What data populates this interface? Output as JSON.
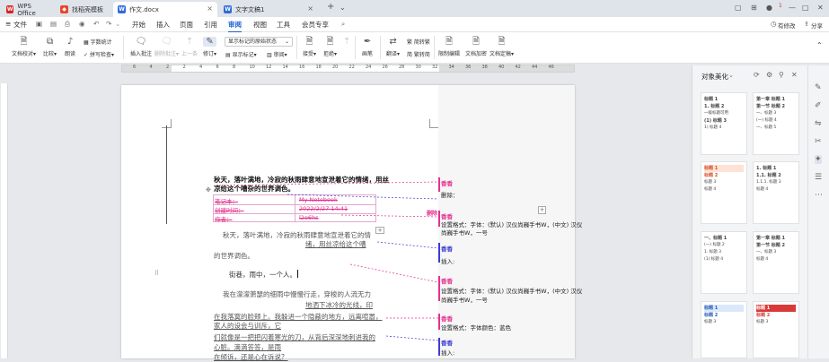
{
  "titlebar": {
    "tabs": [
      {
        "label": "WPS Office",
        "icon": "wps-icon"
      },
      {
        "label": "找稻壳模板",
        "icon": "docer-icon"
      },
      {
        "label": "作文.docx",
        "icon": "word-doc-icon"
      },
      {
        "label": "文字文稿1",
        "icon": "word-doc-icon"
      }
    ],
    "badge": "1"
  },
  "menubar": {
    "file_label": "文件",
    "items": [
      "开始",
      "插入",
      "页面",
      "引用",
      "审阅",
      "视图",
      "工具",
      "会员专享"
    ],
    "active": "审阅",
    "right_label": "有修改",
    "share_label": "分享"
  },
  "ribbon": {
    "buttons": [
      "文档校对",
      "比较",
      "朗读",
      "字数统计",
      "拼写检查",
      "插入批注",
      "删除批注",
      "上一条",
      "下一条",
      "修订",
      "显示标记",
      "审阅",
      "接受",
      "拒绝",
      "画笔",
      "翻译",
      "简转繁",
      "繁转简",
      "限制编辑",
      "文档加密",
      "文档定稿"
    ],
    "markup_combo": "显示标记的原始状态"
  },
  "ruler": {
    "numbers": [
      "6",
      "4",
      "2",
      "2",
      "4",
      "6",
      "8",
      "10",
      "12",
      "14",
      "16",
      "18",
      "20",
      "22",
      "24",
      "26",
      "28",
      "30",
      "32",
      "34",
      "36",
      "38",
      "40",
      "42",
      "44",
      "46"
    ]
  },
  "document": {
    "heading_line1": "秋天，落叶满地，冷寂的秋雨肆意地宣泄着它的情绪，用丝",
    "heading_line2": "凉给这个嘈杂的世界调色。",
    "table": [
      {
        "label": "笔记本：",
        "value": "My Notebook"
      },
      {
        "label": "创建时间：",
        "value": "2022/2/27 14:41"
      },
      {
        "label": "作者：",
        "value": "l2o6hs"
      }
    ],
    "para1_line1": "秋天，落叶满地，冷寂的秋雨肆意地宣泄着它的情",
    "para1_line2": "绪，用丝凉给这个嘈",
    "para1_line3": "的世界调色。",
    "para2": "街巷，雨中，一个人。",
    "para3_line1": "我在濛濛萧瑟的细雨中慢慢行走，穿梭的人流无力",
    "para3_line2": "地洒下冰冷的光线，印",
    "para3_line3": "在我落寞的脸颊上。我躲进一个隐蔽的地方，远离喧嚣，",
    "para3_line4": "家人的设会与训斥，它",
    "para3_line5": "们就像是一把把闪着寒光的刀，从背后深深地刺进我的",
    "para3_line6": "心脏。滴滴答答，是雨",
    "para3_line7": "在倾诉，还是心在诉说？"
  },
  "comments": [
    {
      "author": "香香",
      "text": "删除：",
      "color": "#e6308f"
    },
    {
      "author": "香香",
      "text": "插入:",
      "color": "#3b3bd6"
    },
    {
      "author": "香香",
      "text": "设置格式：字体：(默认) 汉仪尚巍手书W，(中文) 汉仪",
      "text2": "尚巍手书W，一号",
      "color": "#e6308f"
    },
    {
      "author": "香香",
      "text": "插入:",
      "color": "#3b3bd6"
    },
    {
      "author": "香香",
      "text": "设置格式：字体：(默认) 汉仪尚巍手书W，(中文) 汉仪",
      "text2": "尚巍手书W，一号",
      "color": "#e6308f"
    },
    {
      "author": "香香",
      "text": "设置格式：字体颜色：蓝色",
      "color": "#e6308f"
    },
    {
      "author": "香香",
      "text": "插入:",
      "color": "#3b3bd6"
    }
  ],
  "delete_marker": "删除",
  "panel": {
    "title": "对象美化",
    "cards": [
      {
        "l1": "标题 1",
        "l2": "1. 标题 2",
        "l3": "一级标题可用",
        "l4": "(1) 标题 3",
        "l5": "1) 标题 4"
      },
      {
        "l1": "第一章 标题 1",
        "l2": "第一节 标题 2",
        "l3": "一、标题 3",
        "l4": "(一) 标题 4",
        "l5": "一、标题 5"
      },
      {
        "l1": "标题 1",
        "l2": "标题 2",
        "l3": "标题 3",
        "l4": "标题 4",
        "l5": ""
      },
      {
        "l1": "1. 标题 1",
        "l2": "1.1. 标题 2",
        "l3": "1.1.1. 标题 3",
        "l4": "标题 4",
        "l5": ""
      },
      {
        "l1": "一、标题 1",
        "l2": "(一) 标题 2",
        "l3": "1. 标题 3",
        "l4": "(1) 标题 4",
        "l5": ""
      },
      {
        "l1": "第一章 标题 1",
        "l2": "第一节 标题 2",
        "l3": "一、标题 3",
        "l4": "标题 4",
        "l5": ""
      },
      {
        "l1": "标题 1",
        "l2": "标题 2",
        "l3": "标题 3",
        "l4": "",
        "l5": ""
      },
      {
        "l1": "标题 1",
        "l2": "标题 2",
        "l3": "标题 3",
        "l4": "",
        "l5": ""
      }
    ]
  },
  "colors": {
    "accent": "#1a5fd4",
    "markup_pink": "#e6308f",
    "insert_blue": "#3b3bd6"
  }
}
